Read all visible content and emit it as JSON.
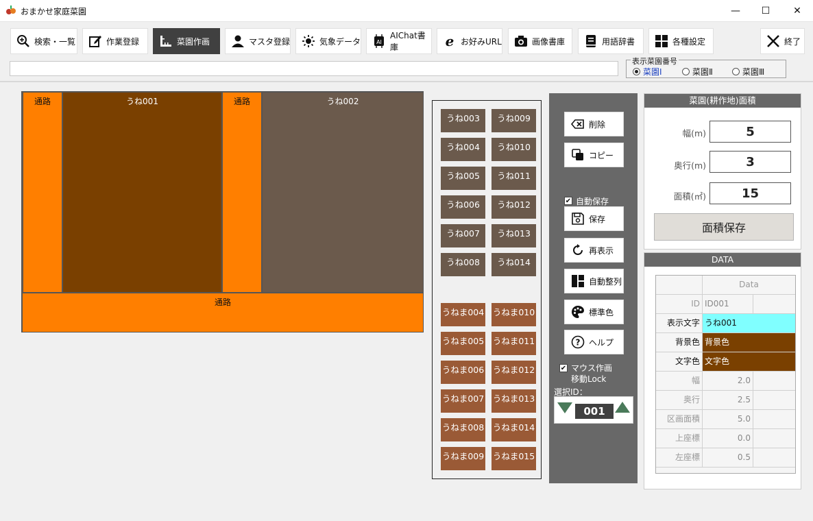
{
  "app": {
    "title": "おまかせ家庭菜園"
  },
  "window": {
    "minimize": "—",
    "maximize": "☐",
    "close": "✕"
  },
  "toolbar": {
    "buttons": [
      {
        "label": "検索・一覧",
        "icon": "magnifier-plus-icon"
      },
      {
        "label": "作業登録",
        "icon": "edit-icon"
      },
      {
        "label": "菜園作画",
        "icon": "ruler-icon",
        "active": true
      },
      {
        "label": "マスタ登録",
        "icon": "person-icon"
      },
      {
        "label": "気象データ",
        "icon": "sun-icon"
      },
      {
        "label": "AIChat書庫",
        "icon": "ai-icon"
      },
      {
        "label": "お好みURL",
        "icon": "browser-e-icon"
      },
      {
        "label": "画像書庫",
        "icon": "camera-icon"
      },
      {
        "label": "用語辞書",
        "icon": "book-icon"
      },
      {
        "label": "各種設定",
        "icon": "grid-icon"
      }
    ],
    "exit_label": "終了",
    "filter_value": ""
  },
  "garden_select": {
    "label": "表示菜園番号",
    "options": [
      "菜園Ⅰ",
      "菜園Ⅱ",
      "菜園Ⅲ"
    ],
    "selected": "菜園Ⅰ"
  },
  "garden": {
    "plots": [
      {
        "label": "通路",
        "kind": "path"
      },
      {
        "label": "うね001",
        "kind": "ridge-selected"
      },
      {
        "label": "通路",
        "kind": "path"
      },
      {
        "label": "うね002",
        "kind": "ridge"
      },
      {
        "label": "通路",
        "kind": "path"
      }
    ]
  },
  "palette": {
    "ridges": [
      "うね003",
      "うね009",
      "うね004",
      "うね010",
      "うね005",
      "うね011",
      "うね006",
      "うね012",
      "うね007",
      "うね013",
      "うね008",
      "うね014"
    ],
    "mounds": [
      "うねま004",
      "うねま010",
      "うねま005",
      "うねま011",
      "うねま006",
      "うねま012",
      "うねま007",
      "うねま013",
      "うねま008",
      "うねま014",
      "うねま009",
      "うねま015"
    ]
  },
  "controls": {
    "delete_label": "削除",
    "copy_label": "コピー",
    "autosave_label": "自動保存",
    "autosave_checked": true,
    "save_label": "保存",
    "refresh_label": "再表示",
    "autoarrange_label": "自動整列",
    "stdcolor_label": "標準色",
    "help_label": "ヘルプ",
    "mouselock_label_1": "マウス作画",
    "mouselock_label_2": "移動Lock",
    "mouselock_checked": true,
    "select_id_label": "選択ID：",
    "select_id_value": "001"
  },
  "area": {
    "title": "菜園(耕作地)面積",
    "width_label": "幅(m)",
    "width_value": "5",
    "depth_label": "奥行(m)",
    "depth_value": "3",
    "area_label": "面積(㎡)",
    "area_value": "15",
    "save_label": "面積保存"
  },
  "data": {
    "title": "DATA",
    "column_header": "Data",
    "rows": [
      {
        "key": "ID",
        "value": "ID001"
      },
      {
        "key": "表示文字",
        "value": "うね001"
      },
      {
        "key": "背景色",
        "value": "背景色"
      },
      {
        "key": "文字色",
        "value": "文字色"
      },
      {
        "key": "幅",
        "value": "2.0"
      },
      {
        "key": "奥行",
        "value": "2.5"
      },
      {
        "key": "区画面積",
        "value": "5.0"
      },
      {
        "key": "上座標",
        "value": "0.0"
      },
      {
        "key": "左座標",
        "value": "0.5"
      }
    ]
  },
  "colors": {
    "path": "#ff7f00",
    "ridge_selected": "#7a4000",
    "ridge": "#6b5a4c",
    "mound": "#9a5a36",
    "panel_dark": "#686868",
    "text_highlight": "#80ffff"
  }
}
